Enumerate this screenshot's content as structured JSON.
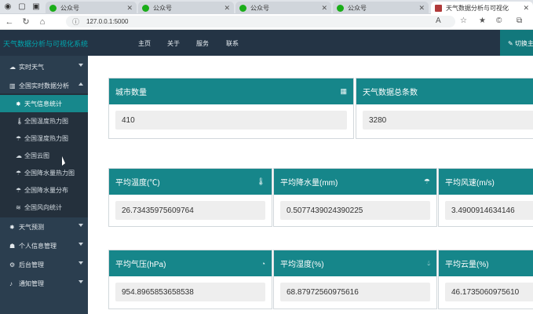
{
  "browser": {
    "tabs": [
      {
        "label": "公众号",
        "active": false
      },
      {
        "label": "公众号",
        "active": false
      },
      {
        "label": "公众号",
        "active": false
      },
      {
        "label": "公众号",
        "active": false
      },
      {
        "label": "天气数据分析与可视化",
        "active": true
      }
    ],
    "url": "127.0.0.1:5000"
  },
  "app": {
    "brand": "天气数据分析与可视化系统",
    "menu": [
      "主页",
      "关于",
      "服务",
      "联系"
    ],
    "switch_label": "切换主"
  },
  "sidebar": {
    "items": [
      {
        "icon": "cloud-icon",
        "label": "实时天气"
      },
      {
        "icon": "chart-icon",
        "label": "全国实时数据分析"
      },
      {
        "icon": "sun-icon",
        "label": "天气信息统计"
      },
      {
        "icon": "thermometer-icon",
        "label": "全国温度热力图"
      },
      {
        "icon": "rain-icon",
        "label": "全国湿度热力图"
      },
      {
        "icon": "cloud-icon",
        "label": "全国云图"
      },
      {
        "icon": "rain-icon",
        "label": "全国降水量热力图"
      },
      {
        "icon": "rain-icon",
        "label": "全国降水量分布"
      },
      {
        "icon": "wind-icon",
        "label": "全国风向统计"
      },
      {
        "icon": "sun-icon",
        "label": "天气预测"
      },
      {
        "icon": "user-icon",
        "label": "个人信息管理"
      },
      {
        "icon": "gears-icon",
        "label": "后台管理"
      },
      {
        "icon": "bell-icon",
        "label": "通知管理"
      }
    ]
  },
  "cards": {
    "city_count": {
      "title": "城市数量",
      "value": "410",
      "icon": "building-icon"
    },
    "total_records": {
      "title": "天气数据总条数",
      "value": "3280"
    },
    "avg_temp": {
      "title": "平均温度(℃)",
      "value": "26.73435975609764",
      "icon": "thermometer-icon"
    },
    "avg_precip": {
      "title": "平均降水量(mm)",
      "value": "0.5077439024390225",
      "icon": "rain-icon"
    },
    "avg_wind": {
      "title": "平均风速(m/s)",
      "value": "3.4900914634146"
    },
    "avg_pressure": {
      "title": "平均气压(hPa)",
      "value": "954.8965853658538",
      "icon": "gauge-icon"
    },
    "avg_humidity": {
      "title": "平均湿度(%)",
      "value": "68.87972560975616",
      "icon": "drop-icon"
    },
    "avg_cloud": {
      "title": "平均云量(%)",
      "value": "46.1735060975610"
    }
  }
}
